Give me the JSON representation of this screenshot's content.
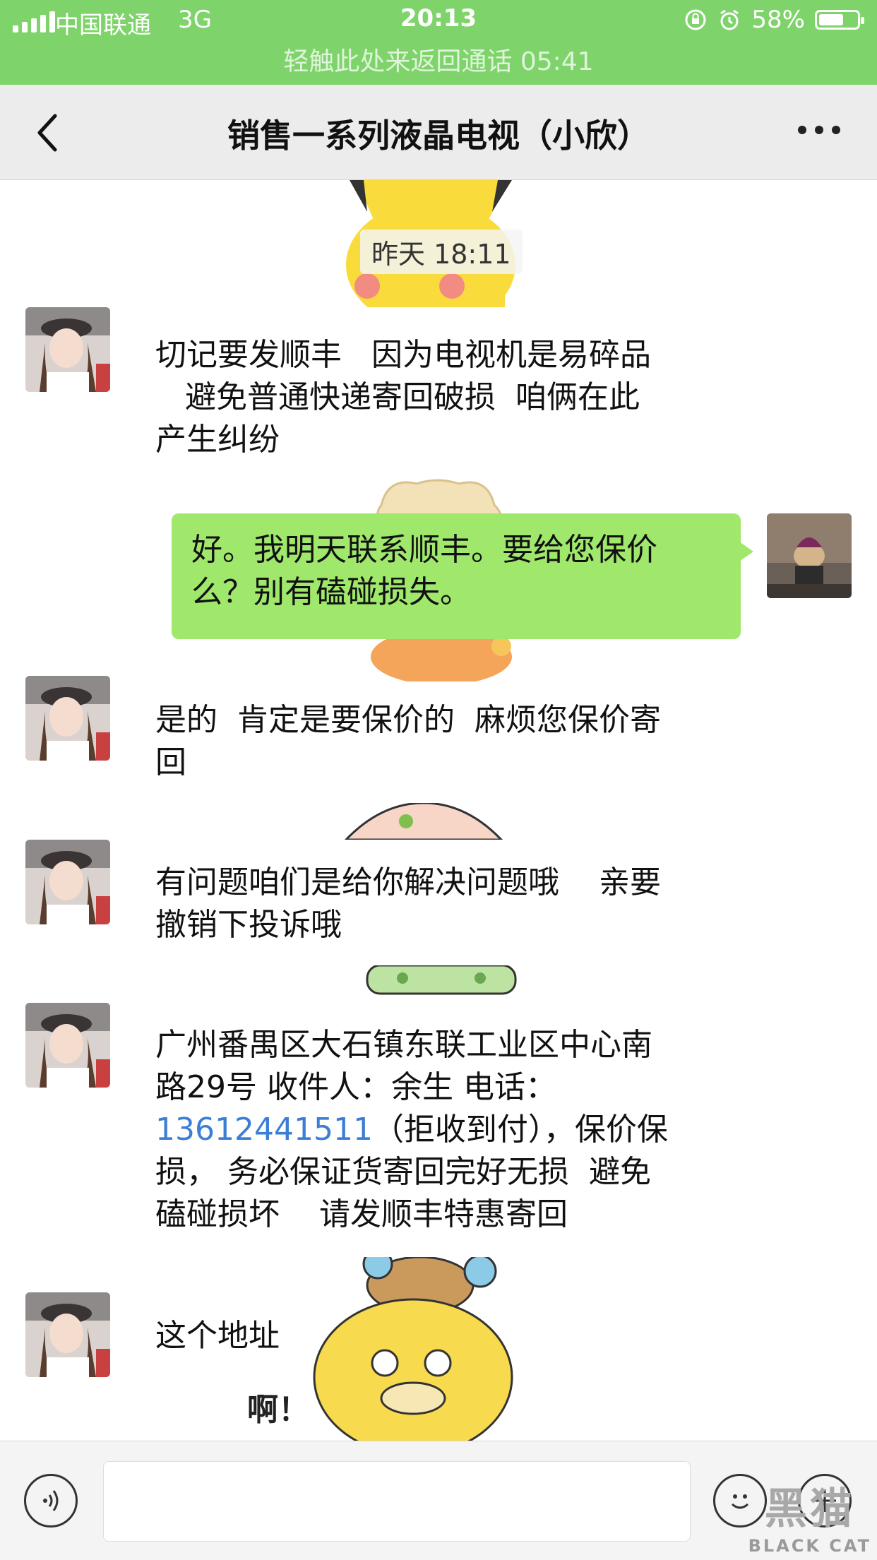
{
  "status_bar": {
    "carrier": "中国联通",
    "network": "3G",
    "time": "20:13",
    "battery": "58%",
    "battery_level": 0.58
  },
  "call_banner": {
    "text": "轻触此处来返回通话 05:41"
  },
  "header": {
    "title": "销售一系列液晶电视（小欣）"
  },
  "timestamp": "昨天 18:11",
  "messages": [
    {
      "sender": "contact",
      "text": "切记要发顺丰   因为电视机是易碎品\n   避免普通快递寄回破损  咱俩在此\n产生纠纷"
    },
    {
      "sender": "me",
      "text": "好。我明天联系顺丰。要给您保价\n么？别有磕碰损失。"
    },
    {
      "sender": "contact",
      "text": "是的  肯定是要保价的  麻烦您保价寄\n回"
    },
    {
      "sender": "contact",
      "text": "有问题咱们是给你解决问题哦    亲要\n撤销下投诉哦"
    },
    {
      "sender": "contact",
      "address_line1": "广州番禺区大石镇东联工业区中心南",
      "address_line2": "路29号 收件人：余生 电话：",
      "phone": "13612441511",
      "address_line3": "（拒收到付），保价保",
      "address_line4": "损， 务必保证货寄回完好无损  避免",
      "address_line5": "磕碰损坏    请发顺丰特惠寄回"
    },
    {
      "sender": "contact",
      "text": "这个地址"
    }
  ],
  "sticker_caption": "啊！",
  "watermark": {
    "cn": "黑猫",
    "en": "BLACK CAT"
  },
  "colors": {
    "accent_green": "#7fd36b",
    "bubble_green": "#9fe86c",
    "link_blue": "#3a7fd5",
    "nav_bg": "#ececec"
  }
}
